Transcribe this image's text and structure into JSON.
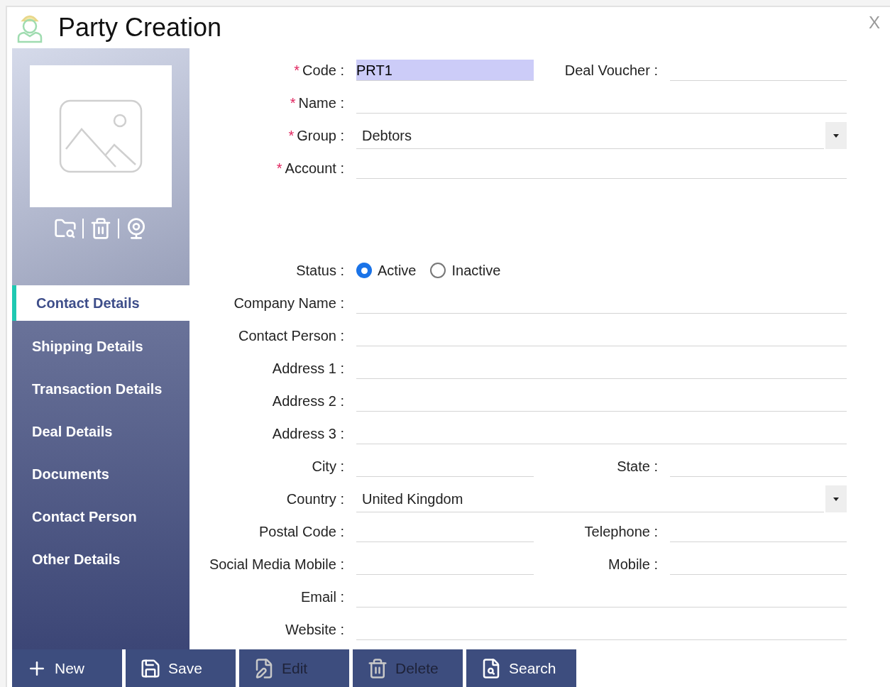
{
  "window": {
    "title": "Party Creation",
    "close": "X"
  },
  "sidebar": {
    "items": [
      {
        "label": "Contact Details",
        "selected": true
      },
      {
        "label": "Shipping Details",
        "selected": false
      },
      {
        "label": "Transaction Details",
        "selected": false
      },
      {
        "label": "Deal Details",
        "selected": false
      },
      {
        "label": "Documents",
        "selected": false
      },
      {
        "label": "Contact Person",
        "selected": false
      },
      {
        "label": "Other Details",
        "selected": false
      }
    ]
  },
  "form": {
    "rows": [
      {
        "kind": "pair",
        "left": {
          "label": "Code :",
          "required_mark": "*",
          "value": "PRT1",
          "highlighted": true
        },
        "right": {
          "label": "Deal Voucher :"
        }
      },
      {
        "kind": "text",
        "label": "Name :",
        "required_mark": "*"
      },
      {
        "kind": "select",
        "label": "Group :",
        "required_mark": "*",
        "value": "Debtors"
      },
      {
        "kind": "text",
        "label": "Account :",
        "required_mark": "*"
      },
      {
        "kind": "radio",
        "label": "Status :",
        "options": [
          {
            "label": "Active",
            "selected": true
          },
          {
            "label": "Inactive",
            "selected": false
          }
        ]
      },
      {
        "kind": "text",
        "label": "Company Name :"
      },
      {
        "kind": "text",
        "label": "Contact Person :"
      },
      {
        "kind": "text",
        "label": "Address 1 :"
      },
      {
        "kind": "text",
        "label": "Address 2 :"
      },
      {
        "kind": "text",
        "label": "Address 3 :"
      },
      {
        "kind": "pair",
        "left": {
          "label": "City :"
        },
        "right": {
          "label": "State :"
        }
      },
      {
        "kind": "select",
        "label": "Country :",
        "value": "United Kingdom"
      },
      {
        "kind": "pair",
        "left": {
          "label": "Postal Code :"
        },
        "right": {
          "label": "Telephone :"
        }
      },
      {
        "kind": "pair",
        "left": {
          "label": "Social Media Mobile :"
        },
        "right": {
          "label": "Mobile :"
        }
      },
      {
        "kind": "text",
        "label": "Email :"
      },
      {
        "kind": "text",
        "label": "Website :"
      }
    ]
  },
  "toolbar": [
    {
      "label": "New",
      "disabled": false
    },
    {
      "label": "Save",
      "disabled": false
    },
    {
      "label": "Edit",
      "disabled": true
    },
    {
      "label": "Delete",
      "disabled": true
    },
    {
      "label": "Search",
      "disabled": false
    }
  ]
}
